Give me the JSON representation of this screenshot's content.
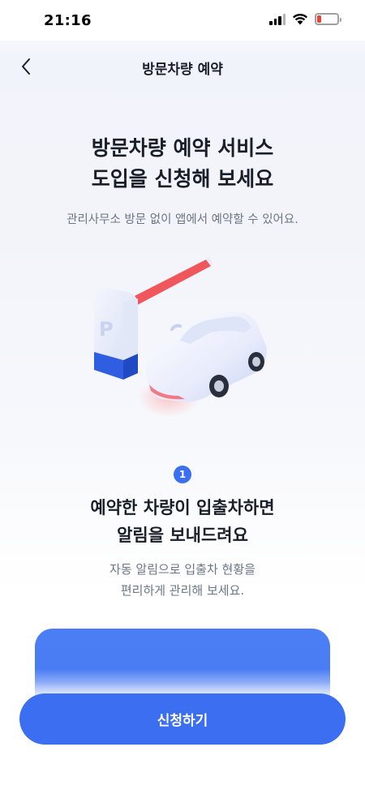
{
  "status_bar": {
    "time": "21:16"
  },
  "nav": {
    "title": "방문차량 예약"
  },
  "hero": {
    "title_line1": "방문차량 예약 서비스",
    "title_line2": "도입을 신청해 보세요",
    "subtitle": "관리사무소 방문 없이 앱에서 예약할 수 있어요."
  },
  "illustration": {
    "booth_letter": "P"
  },
  "step": {
    "number": "1",
    "title_line1": "예약한 차량이 입출차하면",
    "title_line2": "알림을 보내드려요",
    "desc_line1": "자동 알림으로 입출차 현황을",
    "desc_line2": "편리하게 관리해 보세요."
  },
  "cta": {
    "label": "신청하기"
  },
  "colors": {
    "accent": "#3b6ef0",
    "battery_low": "#e8443a",
    "barrier_red": "#f0575c"
  }
}
